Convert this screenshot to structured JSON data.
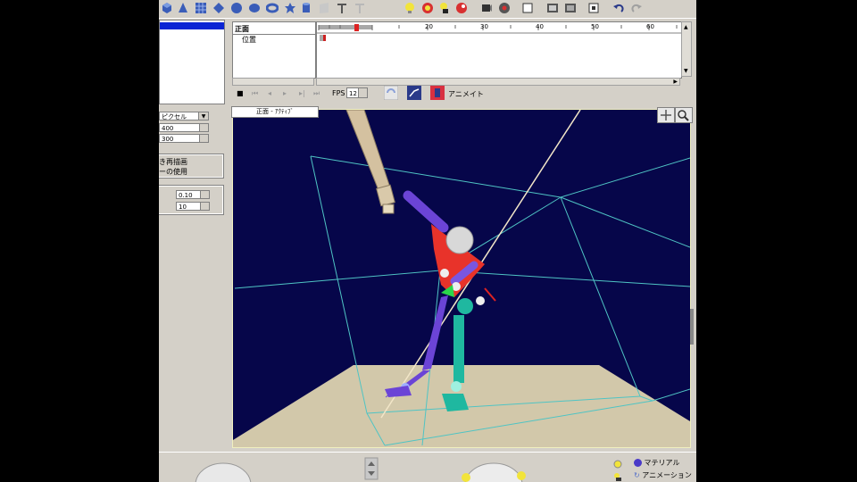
{
  "left_panel": {
    "unit_select": "ピクセル",
    "width_value": "400",
    "height_value": "300",
    "option1": "き再描画",
    "option2": "ーの使用",
    "param1": "0.10",
    "param2": "10"
  },
  "timeline": {
    "track_name_1": "正面",
    "track_name_2": "位置",
    "ruler_ticks": [
      "20",
      "30",
      "40",
      "50",
      "60"
    ],
    "fps_label": "FPS",
    "fps_value": "12",
    "animate_label": "アニメイト"
  },
  "viewport": {
    "title": "正面 - ｱｸﾃｨﾌﾞ"
  },
  "bottom_menu": {
    "material_label": "マテリアル",
    "animation_label": "アニメーション"
  },
  "colors": {
    "panel": "#d4d0c8",
    "scene_bg": "#06064a",
    "floor": "#d2c8aa",
    "selection": "#0a24d4",
    "torso": "#e8332a",
    "limb_purple": "#6b44d6",
    "limb_teal": "#1fb8a0"
  }
}
